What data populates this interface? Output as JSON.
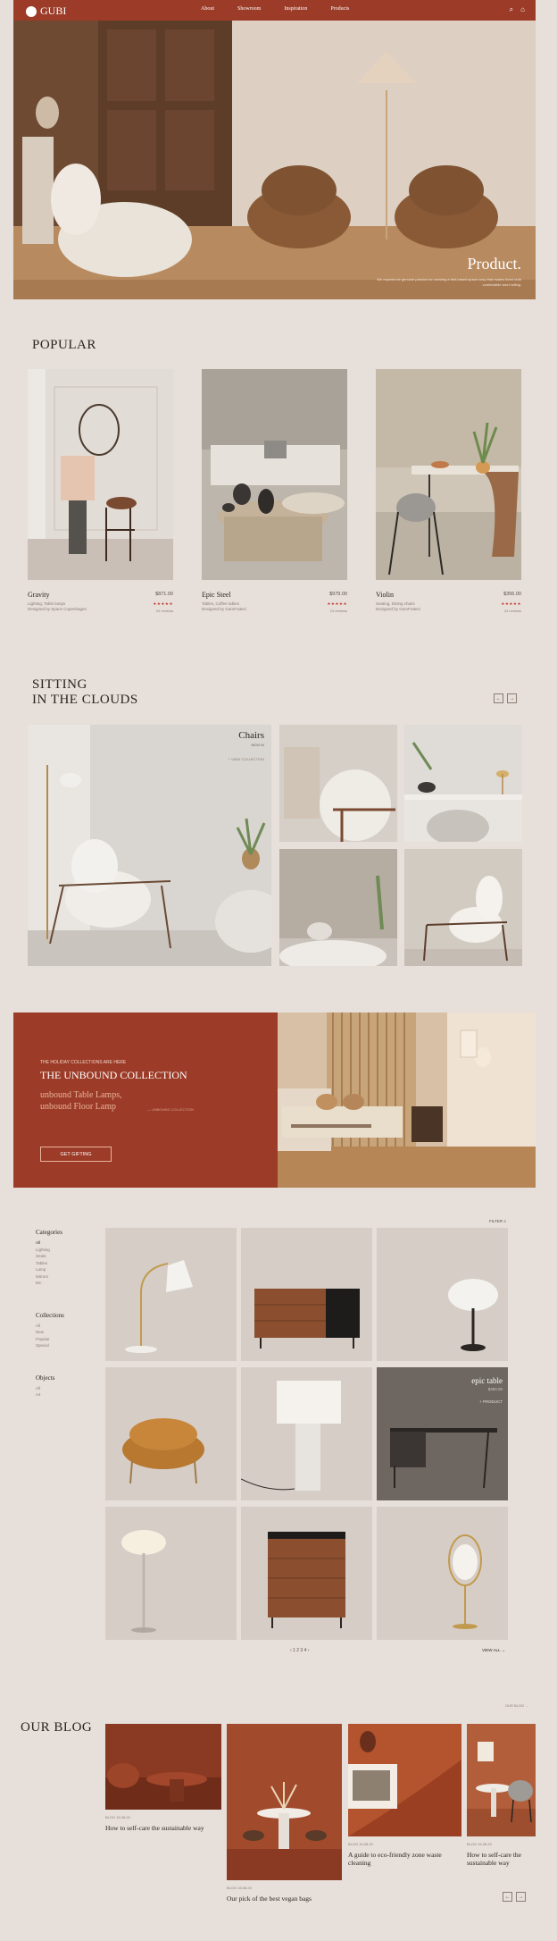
{
  "header": {
    "brand": "GUBI",
    "nav": [
      "About",
      "Showroom",
      "Inspiration",
      "Products"
    ],
    "icons": [
      "search-icon",
      "bag-icon"
    ]
  },
  "hero": {
    "title": "Product.",
    "subtitle": "We experience genuine passion for creating a feel-based space cosy that makes them both comfortable and inviting."
  },
  "popular": {
    "title": "POPULAR",
    "cards": [
      {
        "name": "Gravity",
        "price": "$871.00",
        "category": "Lighting, Table lamps",
        "designer": "Designed by Space Copenhagen",
        "stars": "★★★★★",
        "reviews": "24 reviews"
      },
      {
        "name": "Epic Steel",
        "price": "$979.00",
        "category": "Tables, Coffee tables",
        "designer": "Designed by GamFratesi",
        "stars": "★★★★★",
        "reviews": "24 reviews"
      },
      {
        "name": "Violin",
        "price": "$356.00",
        "category": "Seating, Dining chairs",
        "designer": "Designed by GamFratesi",
        "stars": "★★★★★",
        "reviews": "24 reviews"
      }
    ]
  },
  "clouds": {
    "title_line1": "SITTING",
    "title_line2": "IN THE CLOUDS",
    "feature_title": "Chairs",
    "feature_sub": "NEW IN",
    "feature_link": "+ VIEW COLLECTION",
    "prev": "←",
    "next": "→"
  },
  "banner": {
    "eyebrow": "THE HOLIDAY COLLECTIONS ARE HERE",
    "title": "THE UNBOUND COLLECTION",
    "line1": "unbound Table Lamps,",
    "line2": "unbound Floor Lamp",
    "aside": "— UNBOUND COLLECTION",
    "button": "GET GIFTING"
  },
  "products": {
    "filter": "FILTER ≡",
    "categories_title": "Categories",
    "categories": [
      "All",
      "Lighting",
      "Seats",
      "Tables",
      "Lamp",
      "Mirrors",
      "Etc"
    ],
    "collections_title": "Collections",
    "collections": [
      "All",
      "New",
      "Popular",
      "Special"
    ],
    "objects_title": "Objects",
    "objects": [
      "All",
      "A4"
    ],
    "highlight_title": "epic table",
    "highlight_price": "$390.00",
    "highlight_link": "+ PRODUCT",
    "pagination": "‹ 1 2 3 4 ›",
    "view_all": "VIEW ALL →"
  },
  "blog": {
    "top_link": "OUR BLOG →",
    "title": "OUR BLOG",
    "posts": [
      {
        "date": "BLOG  16.08.20",
        "title": "How to self-care the sustainable way"
      },
      {
        "date": "BLOG  16.08.20",
        "title": "Our pick of the best vegan bags"
      },
      {
        "date": "BLOG  16.08.20",
        "title": "A guide to eco-friendly zone waste cleaning"
      },
      {
        "date": "BLOG  16.08.20",
        "title": "How to self-care the sustainable way"
      }
    ],
    "prev": "←",
    "next": "→"
  }
}
